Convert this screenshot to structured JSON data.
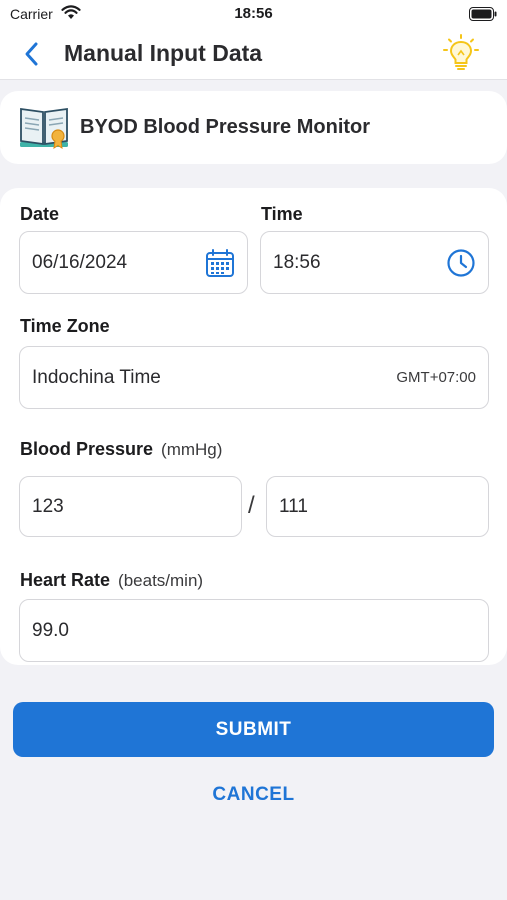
{
  "status_bar": {
    "carrier": "Carrier",
    "time": "18:56"
  },
  "nav": {
    "title": "Manual Input Data",
    "back_icon": "chevron-left-icon",
    "help_icon": "lightbulb-icon"
  },
  "device": {
    "name": "BYOD Blood Pressure Monitor",
    "icon": "book-icon"
  },
  "form": {
    "date": {
      "label": "Date",
      "value": "06/16/2024",
      "icon": "calendar-icon"
    },
    "time": {
      "label": "Time",
      "value": "18:56",
      "icon": "clock-icon"
    },
    "time_zone": {
      "label": "Time Zone",
      "value": "Indochina Time",
      "offset": "GMT+07:00"
    },
    "blood_pressure": {
      "label": "Blood Pressure",
      "unit": "(mmHg)",
      "systolic": "123",
      "separator": "/",
      "diastolic": "111"
    },
    "heart_rate": {
      "label": "Heart Rate",
      "unit": "(beats/min)",
      "value": "99.0"
    }
  },
  "actions": {
    "submit": "SUBMIT",
    "cancel": "CANCEL"
  },
  "colors": {
    "accent": "#1f75d6",
    "background": "#f2f2f6",
    "card": "#ffffff",
    "bulb": "#f5c518"
  }
}
